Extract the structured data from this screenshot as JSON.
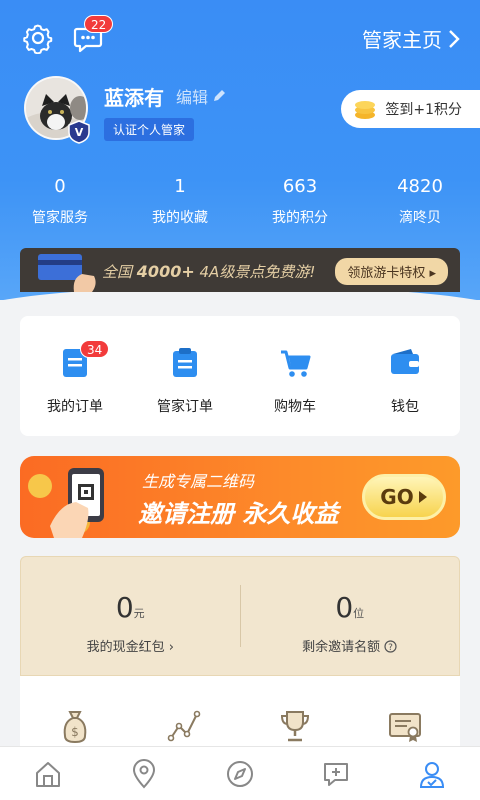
{
  "header": {
    "notification_count": "22",
    "home_link": "管家主页"
  },
  "profile": {
    "name": "蓝添有",
    "edit_label": "编辑",
    "verify_label": "认证个人管家",
    "checkin_label": "签到+1积分"
  },
  "stats": [
    {
      "value": "0",
      "label": "管家服务"
    },
    {
      "value": "1",
      "label": "我的收藏"
    },
    {
      "value": "663",
      "label": "我的积分"
    },
    {
      "value": "4820",
      "label": "滴咚贝"
    }
  ],
  "promo": {
    "text_prefix": "全国",
    "text_highlight": "4000+",
    "text_suffix": "4A级景点免费游!",
    "button": "领旅游卡特权"
  },
  "orders": [
    {
      "label": "我的订单",
      "badge": "34",
      "icon": "order-list-icon"
    },
    {
      "label": "管家订单",
      "icon": "butler-order-icon"
    },
    {
      "label": "购物车",
      "icon": "cart-icon"
    },
    {
      "label": "钱包",
      "icon": "wallet-icon"
    }
  ],
  "invite": {
    "line1": "生成专属二维码",
    "line2": "邀请注册 永久收益",
    "go": "GO"
  },
  "wallet": {
    "cash_value": "0",
    "cash_unit": "元",
    "cash_label": "我的现金红包",
    "invite_value": "0",
    "invite_unit": "位",
    "invite_label": "剩余邀请名额"
  },
  "colors": {
    "primary": "#3a8df5",
    "badge_red": "#f23b3b",
    "promo_gold": "#f1d7a6",
    "invite_orange": "#fb6b23"
  }
}
